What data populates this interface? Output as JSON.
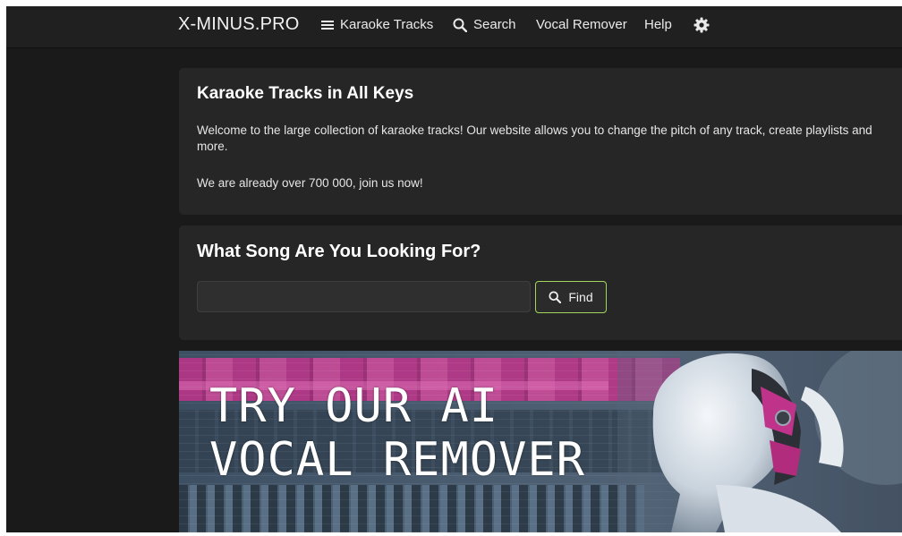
{
  "navbar": {
    "brand": "X-MINUS.PRO",
    "items": [
      {
        "label": "Karaoke Tracks",
        "icon": "menu-icon"
      },
      {
        "label": "Search",
        "icon": "search-icon"
      },
      {
        "label": "Vocal Remover"
      },
      {
        "label": "Help"
      }
    ],
    "settings_icon": "gear-icon"
  },
  "about": {
    "title": "Karaoke Tracks in All Keys",
    "paragraph1": "Welcome to the large collection of karaoke tracks! Our website allows you to change the pitch of any track, create playlists and more.",
    "paragraph2": "We are already over 700 000, join us now!"
  },
  "search": {
    "title": "What Song Are You Looking For?",
    "input_value": "",
    "input_placeholder": "",
    "button_label": "Find"
  },
  "banner": {
    "line1": "TRY OUR AI",
    "line2": "VOCAL REMOVER"
  },
  "colors": {
    "background": "#1a1a1a",
    "navbar": "#202020",
    "card": "#262626",
    "accent_border": "#a4d65e",
    "banner_pink": "#c0338a"
  }
}
